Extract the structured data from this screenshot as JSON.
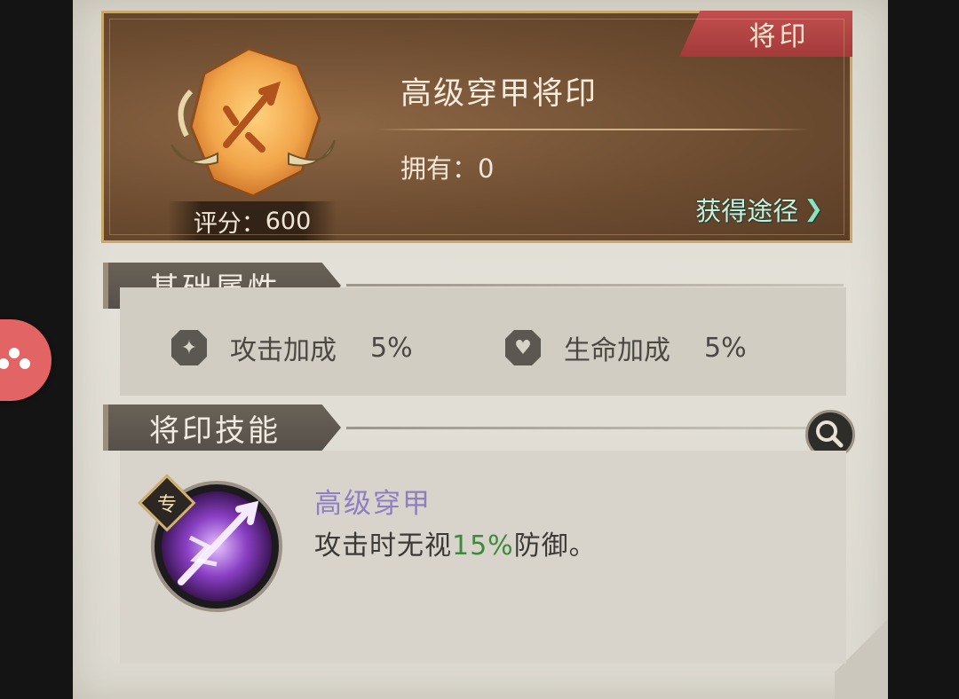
{
  "header": {
    "type_ribbon": "将印",
    "item_name": "高级穿甲将印",
    "owned_label": "拥有：",
    "owned_count": "0",
    "score_label": "评分：",
    "score_value": "600",
    "obtain_link": "获得途径"
  },
  "sections": {
    "base_attrs_title": "基础属性",
    "skill_title": "将印技能"
  },
  "attributes": [
    {
      "name": "攻击加成",
      "value": "5%",
      "icon": "attack-bonus-icon"
    },
    {
      "name": "生命加成",
      "value": "5%",
      "icon": "health-bonus-icon"
    }
  ],
  "skill": {
    "badge": "专",
    "name": "高级穿甲",
    "desc_prefix": "攻击时无视",
    "desc_highlight": "15%",
    "desc_suffix": "防御。"
  },
  "colors": {
    "ribbon": "#b84545",
    "skill_name": "#8d7fc2",
    "highlight": "#3d8a3d",
    "obtain_link": "#cdeedd",
    "side_button": "#e26464"
  }
}
